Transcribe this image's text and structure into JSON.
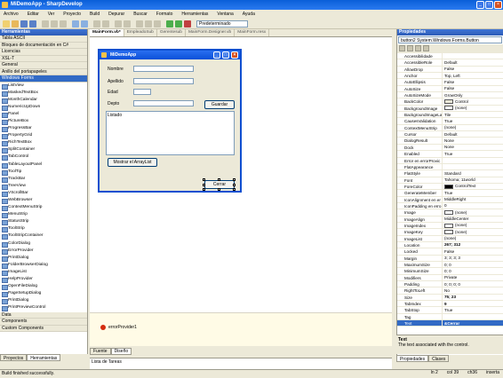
{
  "app": {
    "title": "MiDemoApp - SharpDevelop"
  },
  "menu": [
    "Archivo",
    "Editar",
    "Ver",
    "Proyecto",
    "Build",
    "Depurar",
    "Buscar",
    "Formato",
    "Herramientas",
    "Ventana",
    "Ayuda"
  ],
  "toolbar": {
    "config": "Predeterminado"
  },
  "tools": {
    "title": "Herramientas",
    "categories_top": [
      "Tabla ASCII",
      "Bloques de documentación en C#",
      "Licencias",
      "XSL-T",
      "General",
      "Anillo del portapapeles",
      "Windows Forms"
    ],
    "items": [
      "ListView",
      "MaskedTextBox",
      "MonthCalendar",
      "NumericUpDown",
      "Panel",
      "PictureBox",
      "ProgressBar",
      "PropertyGrid",
      "RichTextBox",
      "SplitContainer",
      "TabControl",
      "TableLayoutPanel",
      "ToolTip",
      "TrackBar",
      "TreeView",
      "VScrollBar",
      "WebBrowser",
      "ContextMenuStrip",
      "MenuStrip",
      "StatusStrip",
      "ToolStrip",
      "ToolStripContainer",
      "ColorDialog",
      "ErrorProvider",
      "PrintDialog",
      "FolderBrowserDialog",
      "ImageList",
      "HelpProvider",
      "OpenFileDialog",
      "PageSetupDialog",
      "PrintDialog",
      "PrintPreviewControl"
    ],
    "categories_bottom": [
      "Data",
      "Components",
      "Custom Components"
    ],
    "tabs": [
      "Proyectos",
      "Herramientas"
    ]
  },
  "doctabs": [
    "MainForm.vb*",
    "EmpleadoSub",
    "Gerentesub",
    "MainForm.Designer.vb",
    "MainForm.resx"
  ],
  "form": {
    "title": "MiDemoApp",
    "labels": {
      "nombre": "Nombre",
      "apellido": "Apellido",
      "edad": "Edad",
      "depto": "Depto",
      "listado": "Listado"
    },
    "buttons": {
      "guardar": "Guardar",
      "mostrar": "Mostrar el ArrayList",
      "cerrar": "Cerrar"
    }
  },
  "tray": {
    "component": "errorProvider1"
  },
  "viewtabs": [
    "Fuente",
    "Diseño"
  ],
  "errorlist": {
    "title": "Lista de Tareas"
  },
  "props": {
    "title": "Propiedades",
    "object": "button2  System.Windows.Forms.Button",
    "rows": [
      {
        "k": "Accessibilidade",
        "v": ""
      },
      {
        "k": "AccessibleRole",
        "v": "Default"
      },
      {
        "k": "AllowDrop",
        "v": "False"
      },
      {
        "k": "Anchor",
        "v": "Top, Left"
      },
      {
        "k": "AutoEllipsis",
        "v": "False"
      },
      {
        "k": "AutoSize",
        "v": "False"
      },
      {
        "k": "AutoSizeMode",
        "v": "GrowOnly"
      },
      {
        "k": "BackColor",
        "v": "Control",
        "sw": "#ece9d8"
      },
      {
        "k": "BackgroundImage",
        "v": "(none)",
        "sw": "#ffffff"
      },
      {
        "k": "BackgroundImageLa",
        "v": "Tile"
      },
      {
        "k": "CausesValidation",
        "v": "True"
      },
      {
        "k": "ContextMenuStrip",
        "v": "(none)"
      },
      {
        "k": "Cursor",
        "v": "Default"
      },
      {
        "k": "DialogResult",
        "v": "None"
      },
      {
        "k": "Dock",
        "v": "None"
      },
      {
        "k": "Enabled",
        "v": "True"
      },
      {
        "k": "Error en errorProvic",
        "v": ""
      },
      {
        "k": "FlatAppearance",
        "v": ""
      },
      {
        "k": "FlatStyle",
        "v": "Standard"
      },
      {
        "k": "Font",
        "v": "Tahoma; 11world"
      },
      {
        "k": "ForeColor",
        "v": "ControlText",
        "sw": "#000000"
      },
      {
        "k": "GenerateMember",
        "v": "True"
      },
      {
        "k": "IconAlignment en er",
        "v": "MiddleRight"
      },
      {
        "k": "IconPadding en erro",
        "v": "0"
      },
      {
        "k": "Image",
        "v": "(none)",
        "sw": "#ffffff"
      },
      {
        "k": "ImageAlign",
        "v": "MiddleCenter"
      },
      {
        "k": "ImageIndex",
        "v": "(none)",
        "sw": "#ffffff"
      },
      {
        "k": "ImageKey",
        "v": "(none)",
        "sw": "#ffffff"
      },
      {
        "k": "ImageList",
        "v": "(none)"
      },
      {
        "k": "Location",
        "v": "267; 312",
        "b": true
      },
      {
        "k": "Locked",
        "v": "False"
      },
      {
        "k": "Margin",
        "v": "3; 3; 3; 3"
      },
      {
        "k": "MaximumSize",
        "v": "0; 0"
      },
      {
        "k": "MinimumSize",
        "v": "0; 0"
      },
      {
        "k": "Modifiers",
        "v": "Private"
      },
      {
        "k": "Padding",
        "v": "0; 0; 0; 0"
      },
      {
        "k": "RightToLeft",
        "v": "No"
      },
      {
        "k": "Size",
        "v": "75; 23",
        "b": true
      },
      {
        "k": "TabIndex",
        "v": "9",
        "b": true
      },
      {
        "k": "TabStop",
        "v": "True"
      },
      {
        "k": "Tag",
        "v": ""
      },
      {
        "k": "Text",
        "v": "&Cerrar",
        "b": true,
        "sel": true
      }
    ],
    "desc_title": "Text",
    "desc": "The text associated with the control.",
    "tabs": [
      "Propiedades",
      "Clases"
    ]
  },
  "status": {
    "text": "Build finished successfully.",
    "ln": "ln 2",
    "col": "col 39",
    "ch": "ch36",
    "mode": "inserta"
  }
}
